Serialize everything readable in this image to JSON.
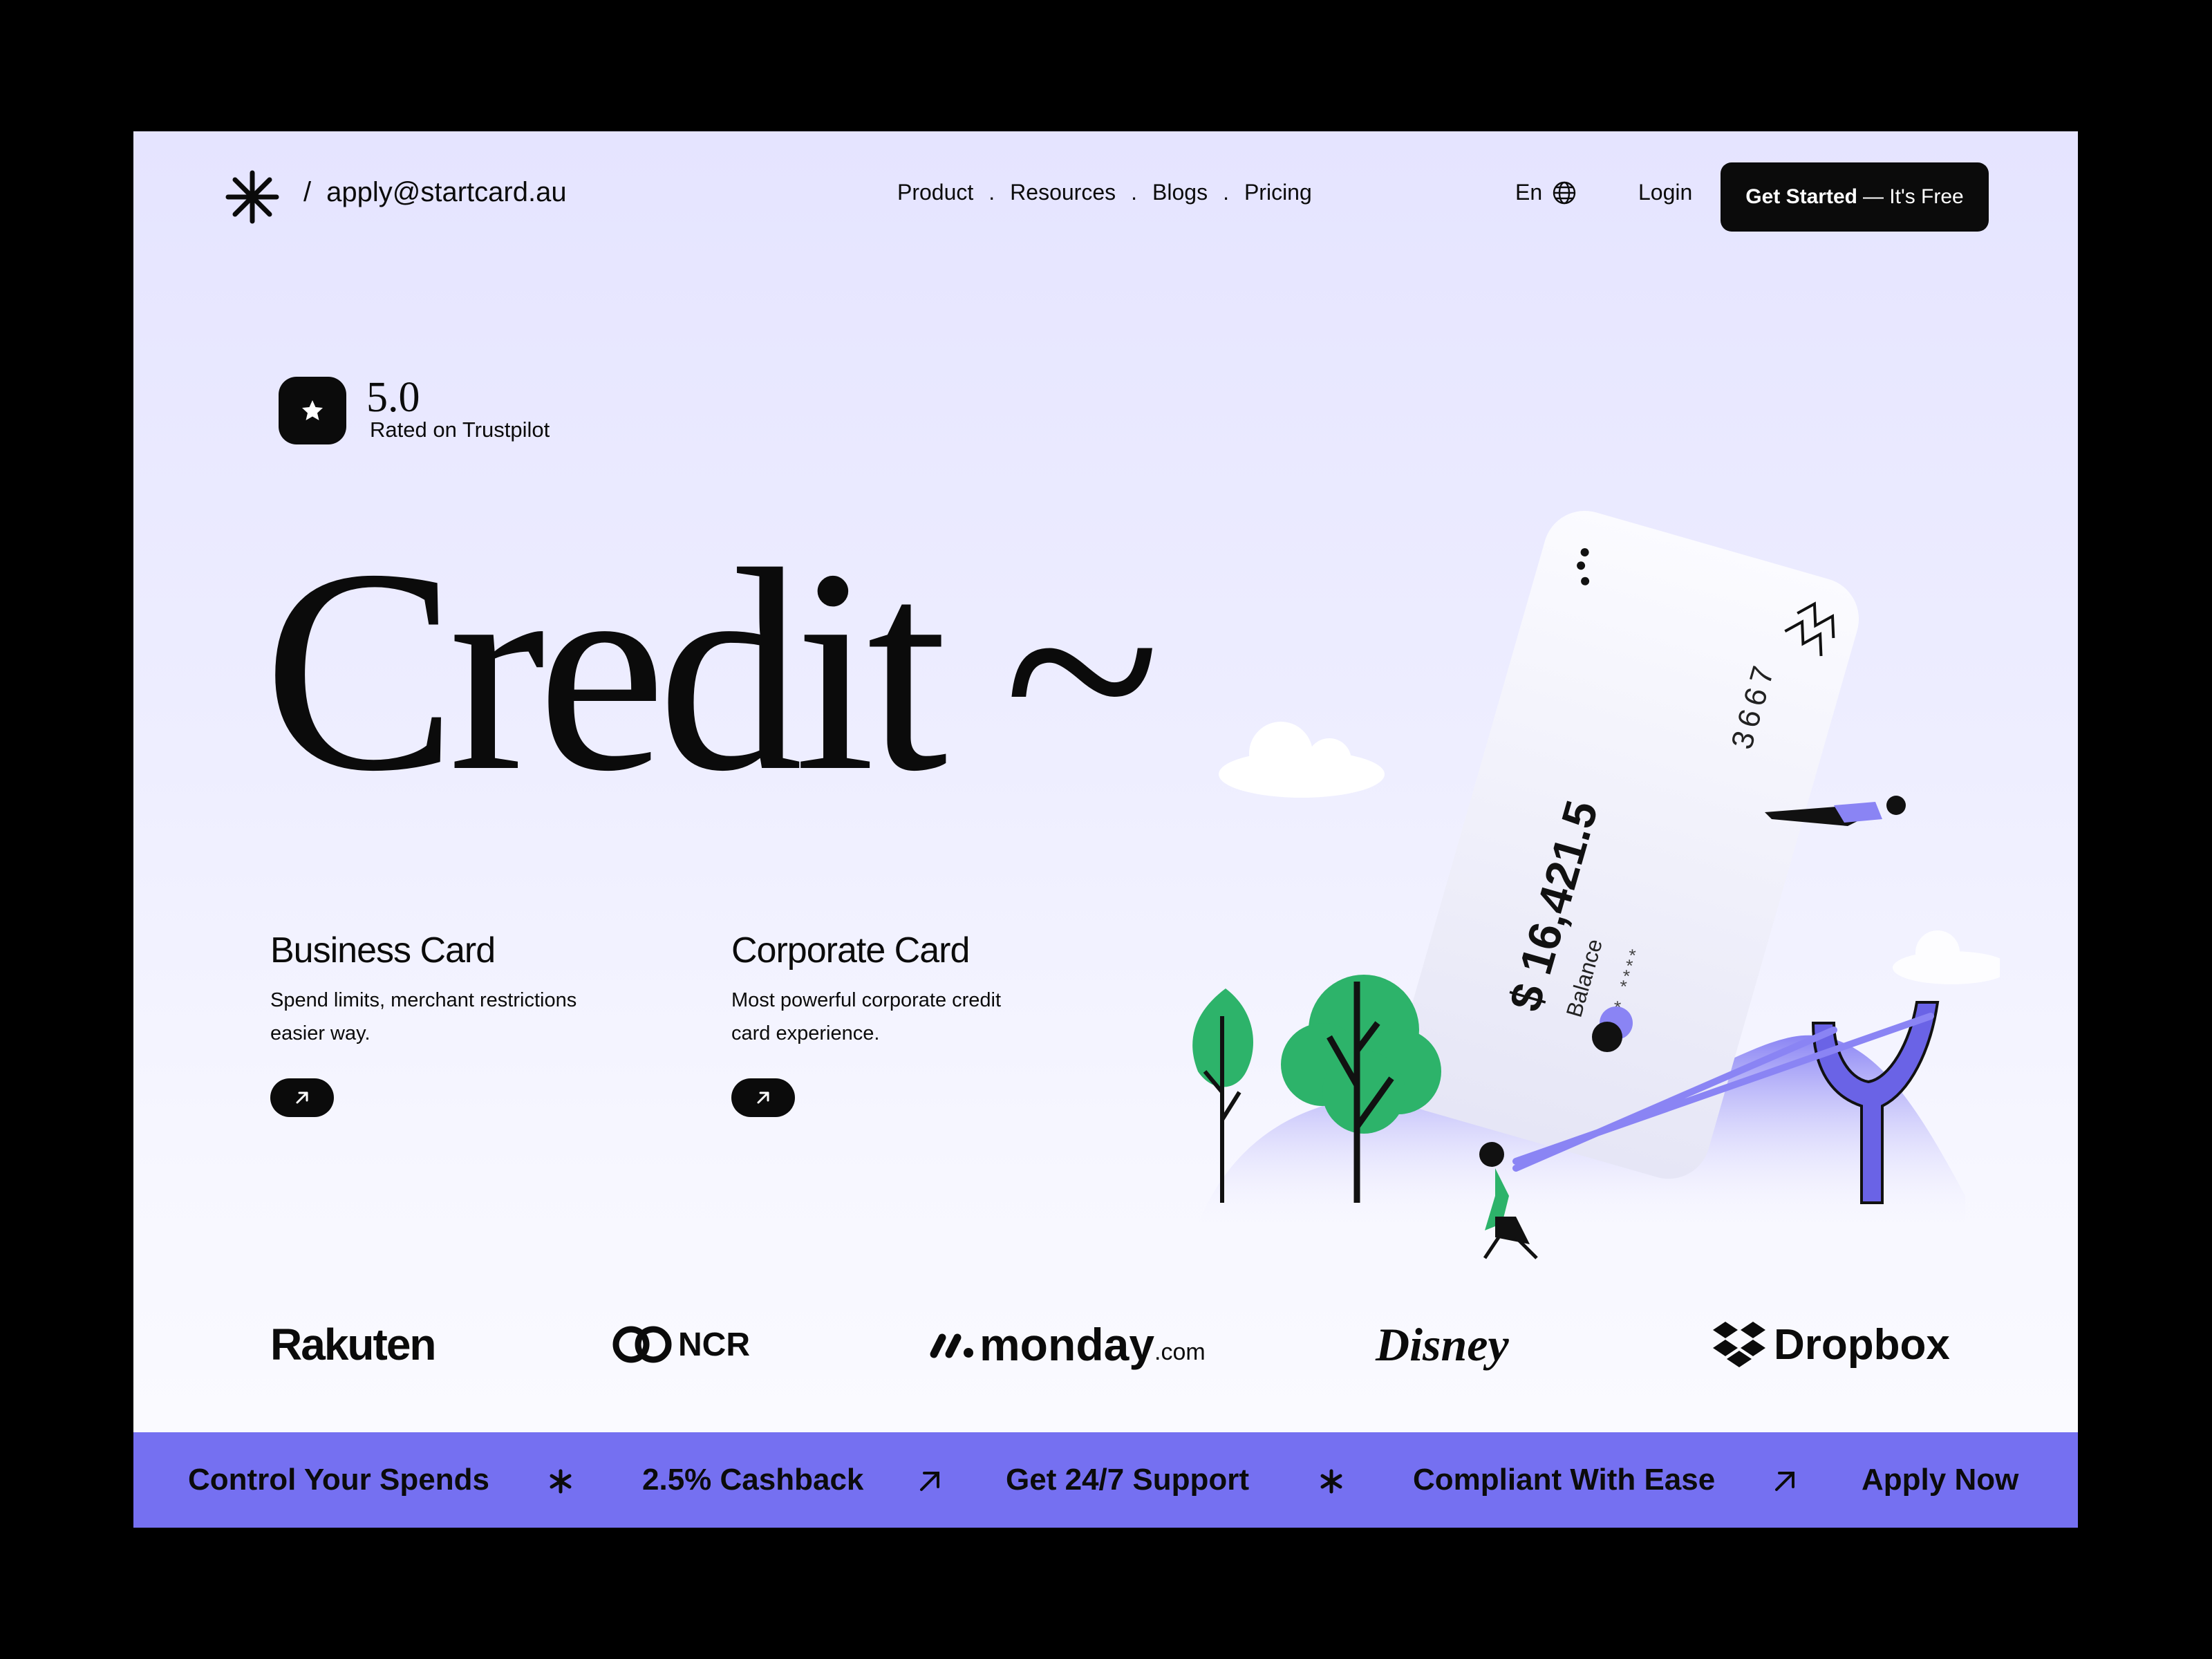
{
  "header": {
    "email": "apply@startcard.au",
    "separator": "/",
    "nav": [
      "Product",
      "Resources",
      "Blogs",
      "Pricing"
    ],
    "nav_separator": ".",
    "language": "En",
    "login": "Login",
    "cta_bold": "Get Started",
    "cta_rest": "— It's Free"
  },
  "rating": {
    "value": "5.0",
    "label": "Rated on Trustpilot"
  },
  "hero": {
    "title": "Credit ~"
  },
  "cards": [
    {
      "title": "Business Card",
      "line1": "Spend limits, merchant restrictions",
      "line2": "easier way."
    },
    {
      "title": "Corporate Card",
      "line1": "Most powerful corporate credit",
      "line2": "card experience."
    }
  ],
  "illustration": {
    "card_number": "3667",
    "balance": "$ 16,421.5",
    "balance_label": "Balance",
    "masked": "**** ****"
  },
  "logos": {
    "rakuten": "Rakuten",
    "ncr": "NCR",
    "monday": "monday",
    "monday_suffix": ".com",
    "disney": "Disney",
    "dropbox": "Dropbox"
  },
  "ticker": {
    "items": [
      "Control Your Spends",
      "2.5% Cashback",
      "Get 24/7 Support",
      "Compliant With Ease",
      "Apply Now"
    ]
  },
  "colors": {
    "accent": "#7570f1",
    "dark": "#0b0b0b",
    "tree_green": "#2db36a",
    "background": "#e5e4ff"
  }
}
